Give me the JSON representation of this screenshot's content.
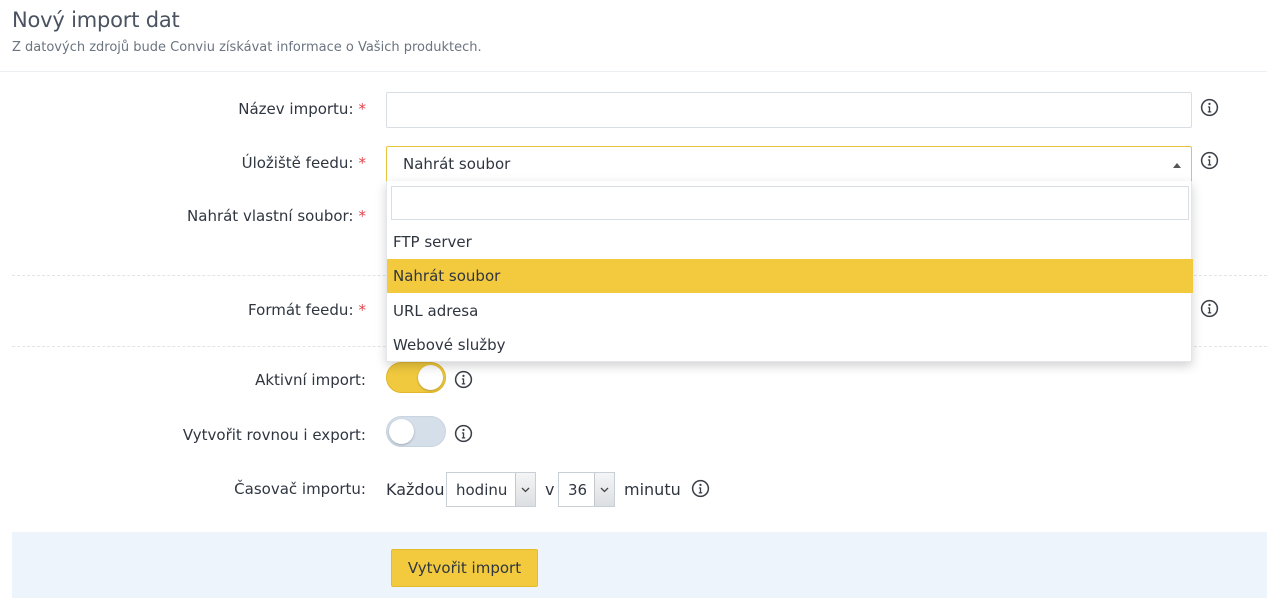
{
  "page": {
    "title": "Nový import dat",
    "subtitle": "Z datových zdrojů bude Conviu získávat informace o Vašich produktech."
  },
  "form": {
    "required_mark": "*",
    "name": {
      "label": "Název importu:",
      "value": ""
    },
    "storage": {
      "label": "Úložiště feedu:",
      "selected": "Nahrát soubor",
      "search_value": "",
      "options": [
        "FTP server",
        "Nahrát soubor",
        "URL adresa",
        "Webové služby"
      ],
      "selected_index": 1
    },
    "upload": {
      "label": "Nahrát vlastní soubor:"
    },
    "format": {
      "label": "Formát feedu:"
    },
    "active": {
      "label": "Aktivní import:",
      "on": true
    },
    "export": {
      "label": "Vytvořit rovnou i export:",
      "on": false
    },
    "timer": {
      "label": "Časovač importu:",
      "every_word": "Každou",
      "unit_value": "hodinu",
      "at_word": "v",
      "minute_value": "36",
      "minute_word": "minutu"
    },
    "submit_label": "Vytvořit import"
  },
  "colors": {
    "accent": "#f3ca3e",
    "required": "#e0444f",
    "footer_band": "#eef4fb"
  },
  "icons": {
    "info": "info-circle-icon",
    "select_arrow": "caret-up-icon",
    "mini_arrow": "chevron-down-icon"
  }
}
